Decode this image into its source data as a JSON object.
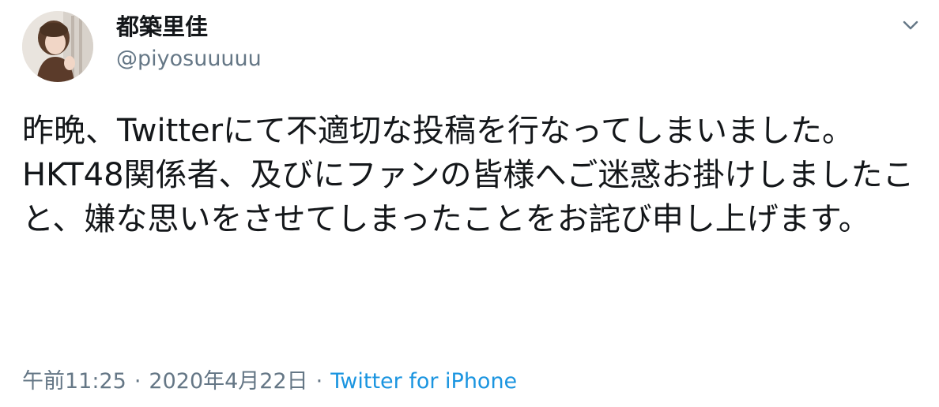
{
  "tweet": {
    "author": {
      "display_name": "都築里佳",
      "handle": "@piyosuuuuu",
      "avatar": "avatar-photo"
    },
    "menu_icon": "chevron-down-icon",
    "text": "昨晩、Twitterにて不適切な投稿を行なってしまいました。\nHKT48関係者、及びにファンの皆様へご迷惑お掛けしましたこと、嫌な思いをさせてしまったことをお詫び申し上げます。",
    "time": "午前11:25",
    "date": "2020年4月22日",
    "separator": "·",
    "source": "Twitter for iPhone"
  },
  "colors": {
    "text": "#14171a",
    "secondary": "#657786",
    "link": "#1b95e0",
    "background": "#ffffff"
  }
}
